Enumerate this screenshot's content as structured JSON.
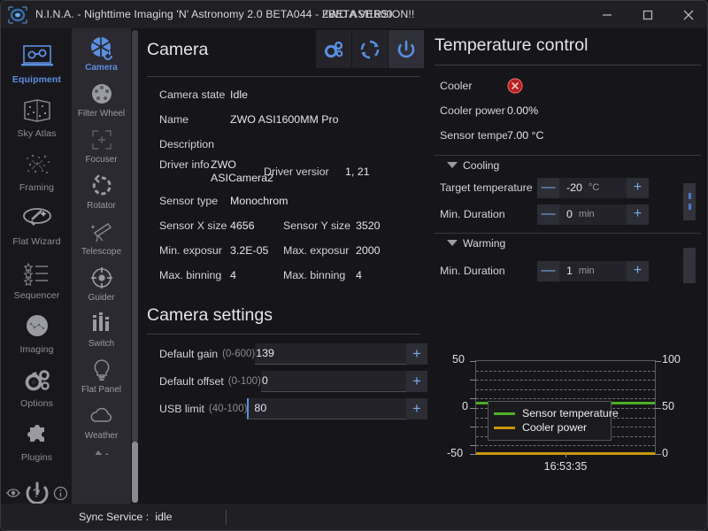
{
  "window": {
    "title_prefix": "N.I.N.A. - Nighttime Imaging 'N' Astronomy 2.0 BETA044  -  ",
    "title_overlay_a": "!!BETA VERSION!!",
    "title_overlay_b": "ZWO ASI1600",
    "logo_icon": "nina-logo-icon",
    "minimize_label": "—",
    "maximize_label": "□",
    "close_label": "✕"
  },
  "rail": {
    "items": [
      {
        "label": "Equipment",
        "icon": "equipment-icon",
        "active": true
      },
      {
        "label": "Sky Atlas",
        "icon": "sky-atlas-icon",
        "active": false
      },
      {
        "label": "Framing",
        "icon": "framing-icon",
        "active": false
      },
      {
        "label": "Flat Wizard",
        "icon": "flat-wizard-icon",
        "active": false
      },
      {
        "label": "Sequencer",
        "icon": "sequencer-icon",
        "active": false
      },
      {
        "label": "Imaging",
        "icon": "imaging-icon",
        "active": false
      },
      {
        "label": "Options",
        "icon": "options-gear-icon",
        "active": false
      },
      {
        "label": "Plugins",
        "icon": "plugins-puzzle-icon",
        "active": false
      }
    ],
    "power_icon": "power-icon",
    "bottom_icons": [
      "eye-icon",
      "question-mark-icon",
      "info-icon"
    ]
  },
  "equipment_tabs": [
    {
      "label": "Camera",
      "icon": "camera-aperture-icon",
      "active": true
    },
    {
      "label": "Filter Wheel",
      "icon": "filter-wheel-icon",
      "active": false
    },
    {
      "label": "Focuser",
      "icon": "focuser-icon",
      "active": false
    },
    {
      "label": "Rotator",
      "icon": "rotator-icon",
      "active": false
    },
    {
      "label": "Telescope",
      "icon": "telescope-icon",
      "active": false
    },
    {
      "label": "Guider",
      "icon": "guider-icon",
      "active": false
    },
    {
      "label": "Switch",
      "icon": "switch-sliders-icon",
      "active": false
    },
    {
      "label": "Flat Panel",
      "icon": "flat-panel-bulb-icon",
      "active": false
    },
    {
      "label": "Weather",
      "icon": "weather-cloud-icon",
      "active": false
    }
  ],
  "camera_panel": {
    "title": "Camera",
    "header_buttons": [
      {
        "name": "settings-gear-icon",
        "label": ""
      },
      {
        "name": "refresh-icon",
        "label": ""
      },
      {
        "name": "connect-power-icon",
        "label": ""
      }
    ],
    "info": {
      "state_label": "Camera state",
      "state_value": "Idle",
      "name_label": "Name",
      "name_value": "ZWO ASI1600MM Pro",
      "description_label": "Description",
      "description_value": "",
      "driver_info_label": "Driver info",
      "driver_info_value": "ZWO ASICamera2",
      "driver_version_label": "Driver versior",
      "driver_version_value": "1, 21",
      "sensor_type_label": "Sensor type",
      "sensor_type_value": "Monochrom",
      "sensor_x_label": "Sensor X size",
      "sensor_x_value": "4656",
      "sensor_y_label": "Sensor Y size",
      "sensor_y_value": "3520",
      "min_exp_label": "Min. exposur",
      "min_exp_value": "3.2E-05",
      "max_exp_label": "Max. exposur",
      "max_exp_value": "2000",
      "max_bin_x_label": "Max. binning",
      "max_bin_x_value": "4",
      "max_bin_y_label": "Max. binning",
      "max_bin_y_value": "4"
    }
  },
  "camera_settings": {
    "title": "Camera settings",
    "rows": [
      {
        "label": "Default gain",
        "range": "(0-600)",
        "value": "139",
        "plus": "+",
        "focused": false
      },
      {
        "label": "Default offset",
        "range": "(0-100)",
        "value": "0",
        "plus": "+",
        "focused": false
      },
      {
        "label": "USB limit",
        "range": "(40-100)",
        "value": "80",
        "plus": "+",
        "focused": true
      }
    ]
  },
  "temperature_control": {
    "title": "Temperature control",
    "cooler_label": "Cooler",
    "cooler_icon": "cooler-off-x-icon",
    "cooler_power_label": "Cooler power",
    "cooler_power_value": "0.00%",
    "sensor_temp_label": "Sensor tempe",
    "sensor_temp_value": "7.00 °C",
    "cooling_group": "Cooling",
    "warming_group": "Warming",
    "cooling_rows": [
      {
        "label": "Target temperature",
        "minus": "—",
        "value": "-20",
        "unit": "°C",
        "plus": "+"
      },
      {
        "label": "Min. Duration",
        "minus": "—",
        "value": "0",
        "unit": "min",
        "plus": "+"
      }
    ],
    "warming_rows": [
      {
        "label": "Min. Duration",
        "minus": "—",
        "value": "1",
        "unit": "min",
        "plus": "+"
      }
    ]
  },
  "chart_data": {
    "type": "line",
    "title": "",
    "xlabel": "",
    "ylabel": "",
    "x_tick_labels": [
      "16:53:35"
    ],
    "left_axis": {
      "label": "",
      "ticks": [
        "50",
        "0",
        "-50"
      ],
      "ylim": [
        -50,
        50
      ]
    },
    "right_axis": {
      "label": "",
      "ticks": [
        "100",
        "50",
        "0"
      ],
      "ylim": [
        0,
        100
      ]
    },
    "grid": true,
    "legend_position": "center-left",
    "series": [
      {
        "name": "Sensor temperature",
        "color": "#4caf28",
        "axis": "left",
        "values": [
          7.0,
          7.0,
          7.0,
          7.0,
          7.0
        ]
      },
      {
        "name": "Cooler power",
        "color": "#c8960f",
        "axis": "right",
        "values": [
          0,
          0,
          0,
          0,
          0
        ]
      }
    ]
  },
  "statusbar": {
    "label": "Sync Service :",
    "value": "idle"
  },
  "colors": {
    "accent": "#5b8fe0",
    "background": "#16161a",
    "panel": "#2a2a30",
    "series_green": "#4caf28",
    "series_orange": "#c8960f",
    "error_red": "#b62020"
  }
}
